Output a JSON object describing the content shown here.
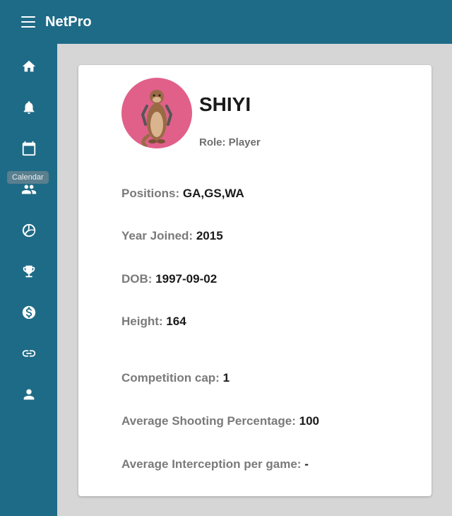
{
  "app": {
    "title": "NetPro"
  },
  "sidebar": {
    "tooltip": "Calendar",
    "items": [
      {
        "icon": "home-icon"
      },
      {
        "icon": "bell-icon"
      },
      {
        "icon": "calendar-icon"
      },
      {
        "icon": "people-icon"
      },
      {
        "icon": "volleyball-icon"
      },
      {
        "icon": "trophy-icon"
      },
      {
        "icon": "dollar-icon"
      },
      {
        "icon": "link-icon"
      },
      {
        "icon": "person-icon"
      }
    ]
  },
  "profile": {
    "name": "SHIYI",
    "role_label": "Role:",
    "role_value": "Player",
    "details": [
      {
        "label": "Positions:",
        "value": "GA,GS,WA"
      },
      {
        "label": "Year Joined:",
        "value": "2015"
      },
      {
        "label": "DOB:",
        "value": "1997-09-02"
      },
      {
        "label": "Height:",
        "value": "164"
      },
      {
        "label": "Competition cap:",
        "value": "1"
      },
      {
        "label": "Average Shooting Percentage:",
        "value": "100"
      },
      {
        "label": "Average Interception per game:",
        "value": "-"
      }
    ]
  }
}
